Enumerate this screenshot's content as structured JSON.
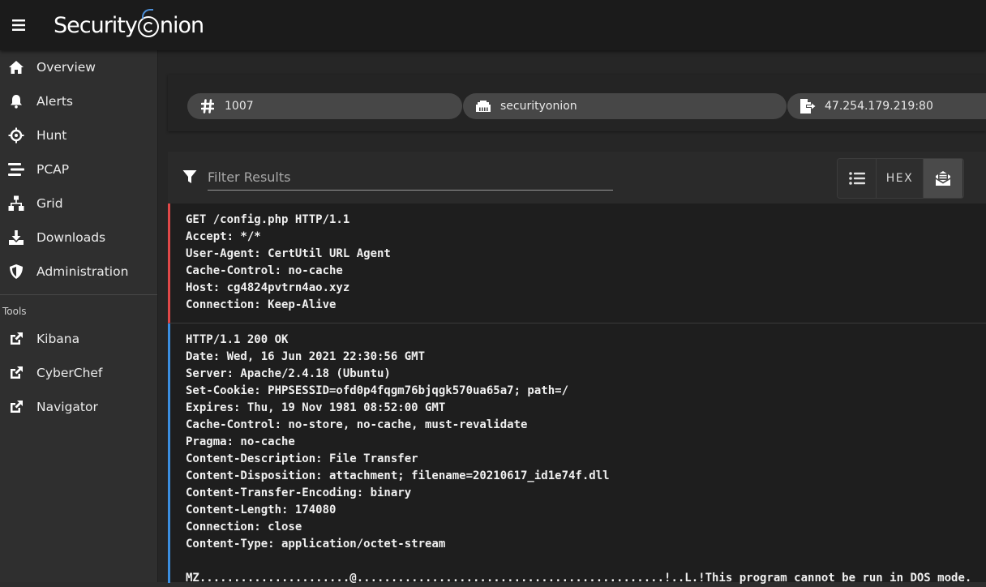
{
  "app": {
    "brand": "Security Onion"
  },
  "sidebar": {
    "items": [
      {
        "label": "Overview",
        "icon": "home-icon"
      },
      {
        "label": "Alerts",
        "icon": "bell-icon"
      },
      {
        "label": "Hunt",
        "icon": "crosshairs-icon"
      },
      {
        "label": "PCAP",
        "icon": "stream-icon"
      },
      {
        "label": "Grid",
        "icon": "network-icon"
      },
      {
        "label": "Downloads",
        "icon": "download-icon"
      },
      {
        "label": "Administration",
        "icon": "shield-icon"
      }
    ],
    "tools_heading": "Tools",
    "tools": [
      {
        "label": "Kibana",
        "icon": "external-link-icon"
      },
      {
        "label": "CyberChef",
        "icon": "external-link-icon"
      },
      {
        "label": "Navigator",
        "icon": "external-link-icon"
      }
    ]
  },
  "chips": {
    "id": "1007",
    "sensor": "securityonion",
    "destination": "47.254.179.219:80"
  },
  "filter": {
    "placeholder": "Filter Results",
    "value": ""
  },
  "view_toggle": {
    "hex_label": "HEX",
    "active": "unwrap"
  },
  "request_lines": [
    "GET /config.php HTTP/1.1",
    "Accept: */*",
    "User-Agent: CertUtil URL Agent",
    "Cache-Control: no-cache",
    "Host: cg4824pvtrn4ao.xyz",
    "Connection: Keep-Alive"
  ],
  "response_lines": [
    "HTTP/1.1 200 OK",
    "Date: Wed, 16 Jun 2021 22:30:56 GMT",
    "Server: Apache/2.4.18 (Ubuntu)",
    "Set-Cookie: PHPSESSID=ofd0p4fqgm76bjqgk570ua65a7; path=/",
    "Expires: Thu, 19 Nov 1981 08:52:00 GMT",
    "Cache-Control: no-store, no-cache, must-revalidate",
    "Pragma: no-cache",
    "Content-Description: File Transfer",
    "Content-Disposition: attachment; filename=20210617_id1e74f.dll",
    "Content-Transfer-Encoding: binary",
    "Content-Length: 174080",
    "Connection: close",
    "Content-Type: application/octet-stream",
    "",
    "MZ......................@.............................................!..L.!This program cannot be run in DOS mode."
  ],
  "colors": {
    "request_marker": "#e04848",
    "response_marker": "#3b8ee0",
    "brand_accent": "#4c8ed6"
  }
}
